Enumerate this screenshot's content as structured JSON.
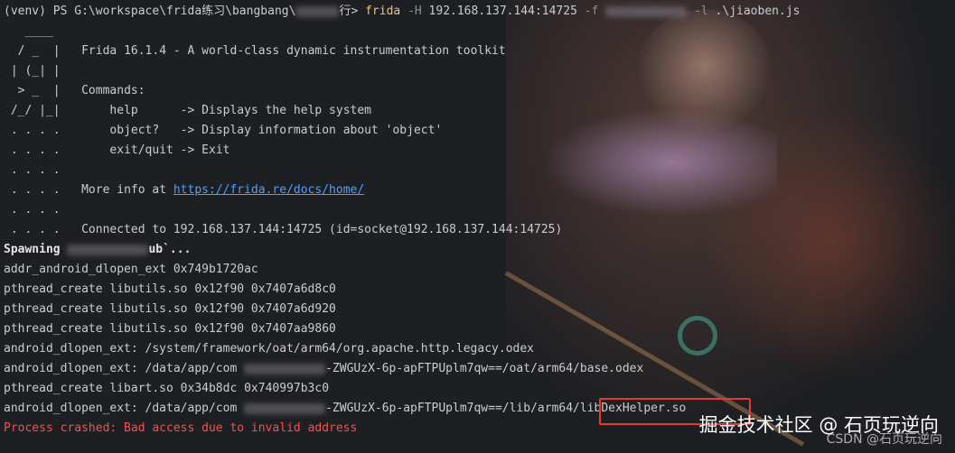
{
  "prompt": {
    "env": "(venv)",
    "ps": "PS G:\\workspace\\frida练习\\bangbang\\",
    "gt": "行>",
    "cmd": "frida",
    "flag_h": "-H",
    "host": "192.168.137.144:14725",
    "flag_f": "-f",
    "flag_l": "-l",
    "script": ".\\jiaoben.js"
  },
  "banner": {
    "art": [
      "   ____",
      "  / _  |",
      " | (_| |",
      "  > _  |",
      " /_/ |_|",
      " . . . .",
      " . . . .",
      " . . . .",
      " . . . .",
      " . . . .",
      " . . . ."
    ],
    "title": "Frida 16.1.4 - A world-class dynamic instrumentation toolkit",
    "commands_label": "Commands:",
    "help_cmd": "    help      -> Displays the help system",
    "object_cmd": "    object?   -> Display information about 'object'",
    "exit_cmd": "    exit/quit -> Exit",
    "more_info": "More info at ",
    "more_info_url": "https://frida.re/docs/home/",
    "connected": "Connected to 192.168.137.144:14725 (id=socket@192.168.137.144:14725)"
  },
  "output": {
    "spawning": "Spawning",
    "spawning_tail": "ub`...",
    "l1": "addr_android_dlopen_ext 0x749b1720ac",
    "l2": "pthread_create libutils.so 0x12f90 0x7407a6d8c0",
    "l3": "pthread_create libutils.so 0x12f90 0x7407a6d920",
    "l4": "pthread_create libutils.so 0x12f90 0x7407aa9860",
    "l5": "android_dlopen_ext: /system/framework/oat/arm64/org.apache.http.legacy.odex",
    "l6a": "android_dlopen_ext: /data/app/com",
    "l6b": "-ZWGUzX-6p-apFTPUplm7qw==/oat/arm64/base.odex",
    "l7": "pthread_create libart.so 0x34b8dc 0x740997b3c0",
    "l8a": "android_dlopen_ext: /data/app/com",
    "l8b": "-ZWGUzX-6p-apFTPUplm7qw==/lib/arm64/",
    "l8c": "libDexHelper.so",
    "crash": "Process crashed: Bad access due to invalid address"
  },
  "watermark": "掘金技术社区 @ 石页玩逆向",
  "csdn": "CSDN @石页玩逆向"
}
